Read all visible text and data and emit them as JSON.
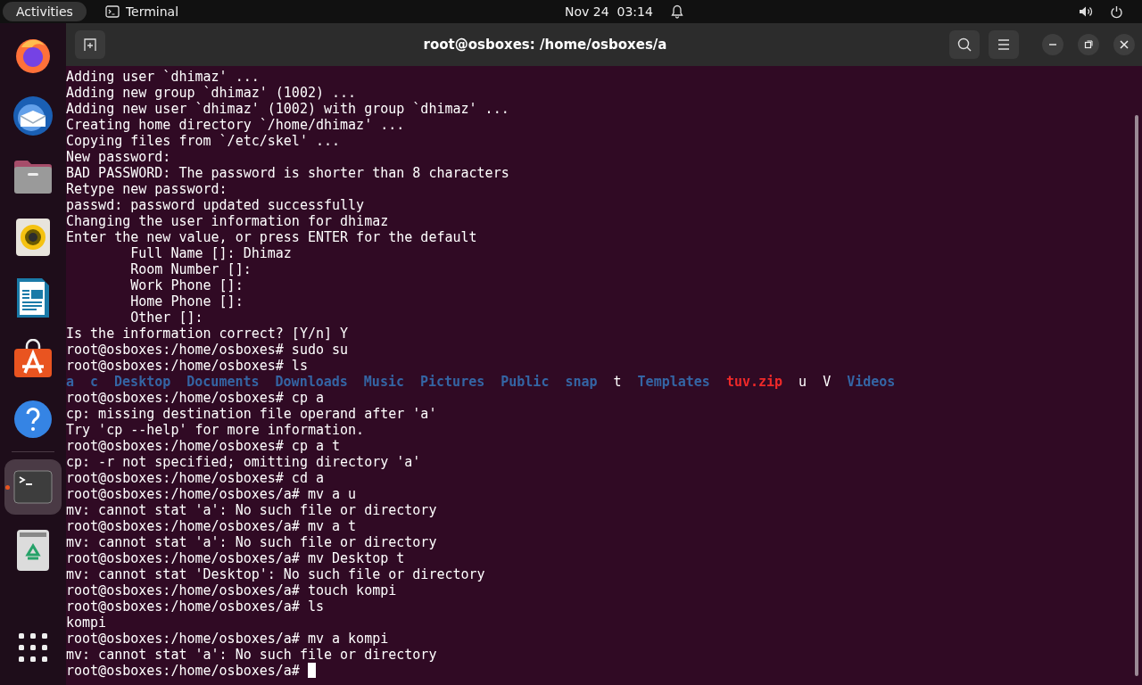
{
  "top_bar": {
    "activities": "Activities",
    "app_name": "Terminal",
    "clock": "Nov 24  03:14"
  },
  "dock": [
    {
      "kind": "browser",
      "selected": false
    },
    {
      "kind": "mail",
      "selected": false
    },
    {
      "kind": "files",
      "selected": false
    },
    {
      "kind": "music",
      "selected": false
    },
    {
      "kind": "document",
      "selected": false
    },
    {
      "kind": "store",
      "selected": false
    },
    {
      "kind": "help",
      "selected": false
    },
    {
      "kind": "terminal",
      "selected": true
    },
    {
      "kind": "trash",
      "selected": false
    },
    {
      "kind": "apps",
      "selected": false
    }
  ],
  "window": {
    "title": "root@osboxes: /home/osboxes/a"
  },
  "terminal": {
    "lines": [
      {
        "text": "Adding user `dhimaz' ..."
      },
      {
        "text": "Adding new group `dhimaz' (1002) ..."
      },
      {
        "text": "Adding new user `dhimaz' (1002) with group `dhimaz' ..."
      },
      {
        "text": "Creating home directory `/home/dhimaz' ..."
      },
      {
        "text": "Copying files from `/etc/skel' ..."
      },
      {
        "text": "New password:"
      },
      {
        "text": "BAD PASSWORD: The password is shorter than 8 characters"
      },
      {
        "text": "Retype new password:"
      },
      {
        "text": "passwd: password updated successfully"
      },
      {
        "text": "Changing the user information for dhimaz"
      },
      {
        "text": "Enter the new value, or press ENTER for the default"
      },
      {
        "text": "        Full Name []: Dhimaz"
      },
      {
        "text": "        Room Number []:"
      },
      {
        "text": "        Work Phone []:"
      },
      {
        "text": "        Home Phone []:"
      },
      {
        "text": "        Other []:"
      },
      {
        "text": "Is the information correct? [Y/n] Y"
      },
      {
        "text": "root@osboxes:/home/osboxes# sudo su"
      },
      {
        "text": "root@osboxes:/home/osboxes# ls"
      },
      {
        "entries": [
          {
            "name": "a",
            "kind": "dir"
          },
          {
            "name": "c",
            "kind": "dir"
          },
          {
            "name": "Desktop",
            "kind": "dir"
          },
          {
            "name": "Documents",
            "kind": "dir"
          },
          {
            "name": "Downloads",
            "kind": "dir"
          },
          {
            "name": "Music",
            "kind": "dir"
          },
          {
            "name": "Pictures",
            "kind": "dir"
          },
          {
            "name": "Public",
            "kind": "dir"
          },
          {
            "name": "snap",
            "kind": "dir"
          },
          {
            "name": "t",
            "kind": "file"
          },
          {
            "name": "Templates",
            "kind": "dir"
          },
          {
            "name": "tuv.zip",
            "kind": "archive"
          },
          {
            "name": "u",
            "kind": "file"
          },
          {
            "name": "V",
            "kind": "file"
          },
          {
            "name": "Videos",
            "kind": "dir"
          }
        ]
      },
      {
        "text": "root@osboxes:/home/osboxes# cp a"
      },
      {
        "text": "cp: missing destination file operand after 'a'"
      },
      {
        "text": "Try 'cp --help' for more information."
      },
      {
        "text": "root@osboxes:/home/osboxes# cp a t"
      },
      {
        "text": "cp: -r not specified; omitting directory 'a'"
      },
      {
        "text": "root@osboxes:/home/osboxes# cd a"
      },
      {
        "text": "root@osboxes:/home/osboxes/a# mv a u"
      },
      {
        "text": "mv: cannot stat 'a': No such file or directory"
      },
      {
        "text": "root@osboxes:/home/osboxes/a# mv a t"
      },
      {
        "text": "mv: cannot stat 'a': No such file or directory"
      },
      {
        "text": "root@osboxes:/home/osboxes/a# mv Desktop t"
      },
      {
        "text": "mv: cannot stat 'Desktop': No such file or directory"
      },
      {
        "text": "root@osboxes:/home/osboxes/a# touch kompi"
      },
      {
        "text": "root@osboxes:/home/osboxes/a# ls"
      },
      {
        "text": "kompi"
      },
      {
        "text": "root@osboxes:/home/osboxes/a# mv a kompi"
      },
      {
        "text": "mv: cannot stat 'a': No such file or directory"
      },
      {
        "text": "root@osboxes:/home/osboxes/a# ",
        "cursor": true
      }
    ]
  }
}
